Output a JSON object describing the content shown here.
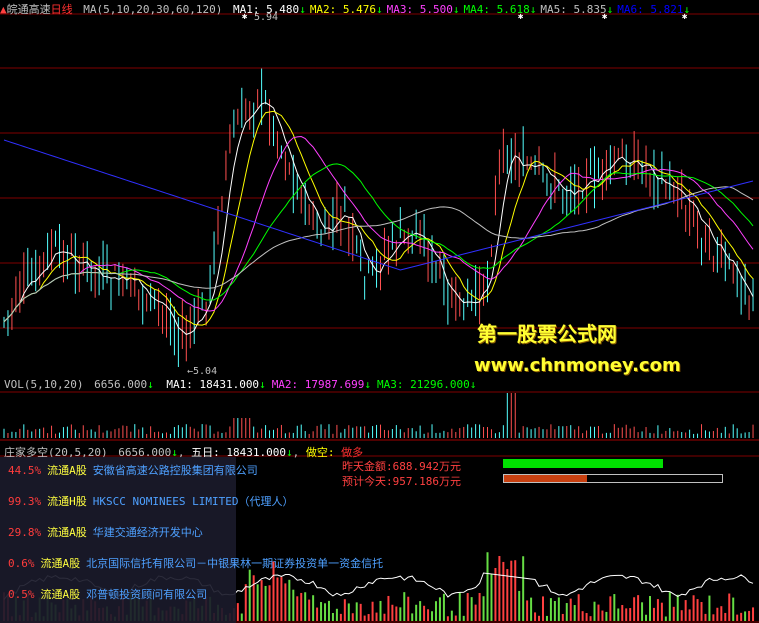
{
  "header": {
    "title": "皖通高速",
    "period": "日线",
    "ma_label": "MA(5,10,20,30,60,120)",
    "ma": [
      {
        "label": "MA1:",
        "value": "5.480",
        "arrow": "↓",
        "color": "#ffffff"
      },
      {
        "label": "MA2:",
        "value": "5.476",
        "arrow": "↓",
        "color": "#ffff00"
      },
      {
        "label": "MA3:",
        "value": "5.500",
        "arrow": "↓",
        "color": "#ff40ff"
      },
      {
        "label": "MA4:",
        "value": "5.618",
        "arrow": "↓",
        "color": "#00ff00"
      },
      {
        "label": "MA5:",
        "value": "5.835",
        "arrow": "↓",
        "color": "#c0c0c0"
      },
      {
        "label": "MA6:",
        "value": "5.821",
        "arrow": "↓",
        "color": "#0000ff"
      }
    ]
  },
  "price_chart": {
    "high_label": "5.94",
    "low_label": "←5.04"
  },
  "watermark": {
    "line1": "第一股票公式网",
    "line2": "www.chnmoney.com"
  },
  "volume_panel": {
    "label": "VOL(5,10,20)",
    "value": "6656.000",
    "arrow": "↓",
    "ma": [
      {
        "label": "MA1:",
        "value": "18431.000",
        "arrow": "↓",
        "color": "#ffffff"
      },
      {
        "label": "MA2:",
        "value": "17987.699",
        "arrow": "↓",
        "color": "#ff40ff"
      },
      {
        "label": "MA3:",
        "value": "21296.000",
        "arrow": "↓",
        "color": "#00ff00"
      }
    ]
  },
  "zj_panel": {
    "label": "庄家多空(20,5,20)",
    "value": "6656.000",
    "arrow": "↓",
    "five_day_label": "五日:",
    "five_day_value": "18431.000",
    "five_day_arrow": "↓",
    "action_label": "做空:",
    "action_value": "做多",
    "yesterday_amount_label": "昨天金额:",
    "yesterday_amount": "688.942万元",
    "estimated_today_label": "预计今天:",
    "estimated_today": "957.186万元",
    "yesterday_ratio": 1.0,
    "estimated_ratio": 0.38,
    "colors": {
      "green": "#00e000",
      "orange": "#c84010"
    }
  },
  "shareholders": [
    {
      "pct": "44.5%",
      "type": "流通A股",
      "name": "安徽省高速公路控股集团有限公司"
    },
    {
      "pct": "99.3%",
      "type": "流通H股",
      "name": "HKSCC NOMINEES LIMITED（代理人）"
    },
    {
      "pct": "29.8%",
      "type": "流通A股",
      "name": "华建交通经济开发中心"
    },
    {
      "pct": "0.6%",
      "type": "流通A股",
      "name": "北京国际信托有限公司－中银果林一期证券投资单一资金信托"
    },
    {
      "pct": "0.5%",
      "type": "流通A股",
      "name": "邓普顿投资顾问有限公司"
    }
  ]
}
